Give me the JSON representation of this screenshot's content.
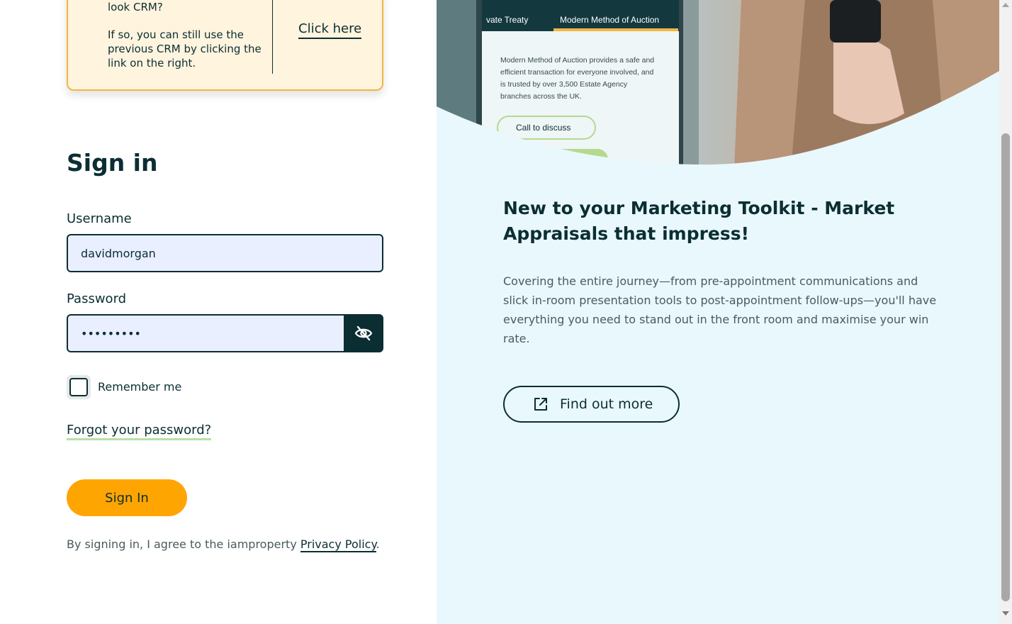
{
  "notice": {
    "question": "look CRM?",
    "body": "If so, you can still use the previous CRM by clicking the link on the right.",
    "link": "Click here"
  },
  "signin": {
    "title": "Sign in",
    "username_label": "Username",
    "username_value": "davidmorgan",
    "password_label": "Password",
    "password_value": "•••••••••",
    "remember_label": "Remember me",
    "forgot_link": "Forgot your password?",
    "submit_label": "Sign In",
    "agree_text": "By signing in, I agree to the iamproperty ",
    "privacy_link": "Privacy Policy",
    "agree_suffix": "."
  },
  "promo": {
    "phone_tab_left": "vate Treaty",
    "phone_tab_right": "Modern Method of Auction",
    "phone_text_1": "Modern Method of Auction provides a safe and",
    "phone_text_2": "efficient transaction for everyone involved, and",
    "phone_text_3": "is trusted by over 3,500 Estate Agency",
    "phone_text_4": "branches across the UK.",
    "phone_button": "Call to discuss",
    "headline": "New to your Marketing Toolkit - Market Appraisals that impress!",
    "description": "Covering the entire journey—from pre-appointment communications and slick in-room presentation tools to post-appointment follow-ups—you'll have everything you need to stand out in the front room and maximise your win rate.",
    "cta": "Find out more"
  },
  "colors": {
    "brand_dark": "#0b2e33",
    "accent_orange": "#ffa502",
    "notice_bg": "#fff4de",
    "panel_bg": "#e9f8fc",
    "input_bg": "#e9effe"
  }
}
